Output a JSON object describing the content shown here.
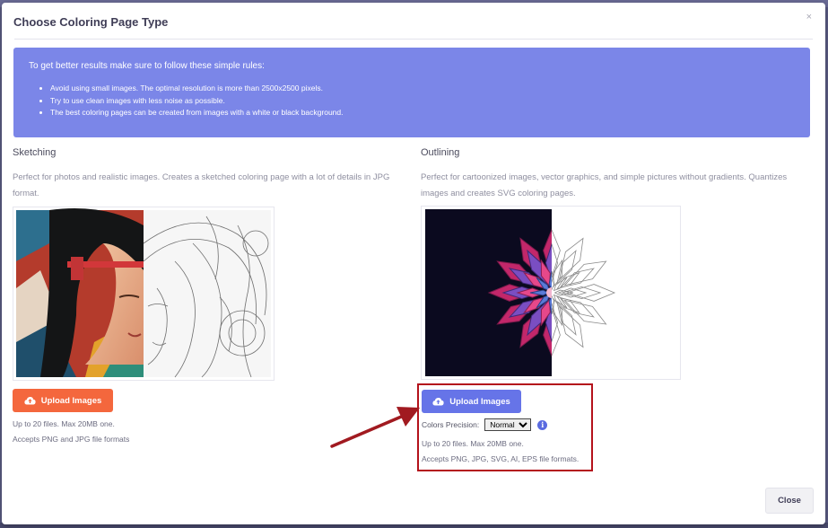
{
  "modal": {
    "title": "Choose Coloring Page Type",
    "close_glyph": "×",
    "close_button": "Close"
  },
  "info": {
    "title": "To get better results make sure to follow these simple rules:",
    "rules": [
      "Avoid using small images. The optimal resolution is more than 2500x2500 pixels.",
      "Try to use clean images with less noise as possible.",
      "The best coloring pages can be created from images with a white or black background."
    ]
  },
  "sketching": {
    "title": "Sketching",
    "description": "Perfect for photos and realistic images. Creates a sketched coloring page with a lot of details in JPG format.",
    "upload_label": "Upload Images",
    "note_line1": "Up to 20 files. Max 20MB one.",
    "note_line2": "Accepts PNG and JPG file formats"
  },
  "outlining": {
    "title": "Outlining",
    "description": "Perfect for cartoonized images, vector graphics, and simple pictures without gradients. Quantizes images and creates SVG coloring pages.",
    "upload_label": "Upload Images",
    "precision_label": "Colors Precision:",
    "precision_value": "Normal",
    "info_glyph": "i",
    "note_line1": "Up to 20 files. Max 20MB one.",
    "note_line2": "Accepts PNG, JPG, SVG, AI, EPS file formats."
  },
  "colors": {
    "info_bg": "#7b86e8",
    "orange": "#f4673d",
    "blue": "#6674e8",
    "highlight": "#b4121b"
  },
  "icons": {
    "upload": "cloud-upload-icon",
    "info": "info-icon",
    "close": "close-icon"
  }
}
